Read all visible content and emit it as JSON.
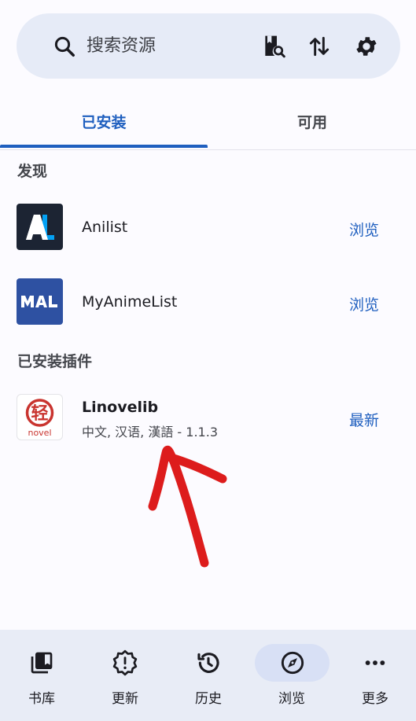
{
  "search": {
    "placeholder": "搜索资源"
  },
  "toolbar": {
    "icons": [
      "search-icon",
      "book-search-icon",
      "sort-arrows-icon",
      "gear-icon"
    ]
  },
  "tabs": [
    {
      "label": "已安装",
      "selected": true
    },
    {
      "label": "可用",
      "selected": false
    }
  ],
  "discover": {
    "header": "发现",
    "items": [
      {
        "name": "Anilist",
        "logo_text": "AL",
        "action": "浏览"
      },
      {
        "name": "MyAnimeList",
        "logo_text": "MAL",
        "action": "浏览"
      }
    ]
  },
  "installed": {
    "header": "已安装插件",
    "items": [
      {
        "name": "Linovelib",
        "subtitle": "中文, 汉语, 漢語 - 1.1.3",
        "logo_text": "轻 novel",
        "action": "最新"
      }
    ]
  },
  "nav": [
    {
      "label": "书库",
      "icon": "library-icon",
      "selected": false
    },
    {
      "label": "更新",
      "icon": "updates-icon",
      "selected": false
    },
    {
      "label": "历史",
      "icon": "history-icon",
      "selected": false
    },
    {
      "label": "浏览",
      "icon": "compass-icon",
      "selected": true
    },
    {
      "label": "更多",
      "icon": "more-icon",
      "selected": false
    }
  ],
  "colors": {
    "accent": "#1f5fbf",
    "annotation_arrow": "#dd1c1c",
    "nav_background": "#e8ecf6",
    "search_background": "#e6ebf7"
  }
}
